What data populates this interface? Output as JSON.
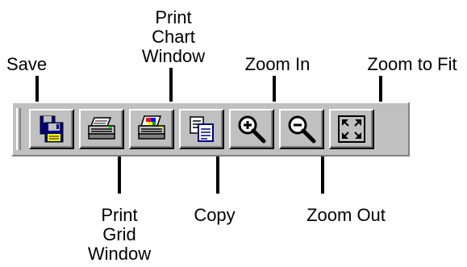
{
  "toolbar": {
    "buttons": [
      {
        "name": "save",
        "icon": "save-icon",
        "label_lines": [
          "Save"
        ]
      },
      {
        "name": "print-grid-window",
        "icon": "printer-icon",
        "label_lines": [
          "Print",
          "Grid",
          "Window"
        ]
      },
      {
        "name": "print-chart-window",
        "icon": "color-printer-icon",
        "label_lines": [
          "Print",
          "Chart",
          "Window"
        ]
      },
      {
        "name": "copy",
        "icon": "copy-icon",
        "label_lines": [
          "Copy"
        ]
      },
      {
        "name": "zoom-in",
        "icon": "zoom-in-icon",
        "label_lines": [
          "Zoom In"
        ]
      },
      {
        "name": "zoom-out",
        "icon": "zoom-out-icon",
        "label_lines": [
          "Zoom Out"
        ]
      },
      {
        "name": "zoom-to-fit",
        "icon": "zoom-to-fit-icon",
        "label_lines": [
          "Zoom to Fit"
        ]
      }
    ]
  },
  "colors": {
    "toolbar_face": "#c0c0c0",
    "floppy_blue": "#000080",
    "floppy_yellow": "#ffff00"
  }
}
